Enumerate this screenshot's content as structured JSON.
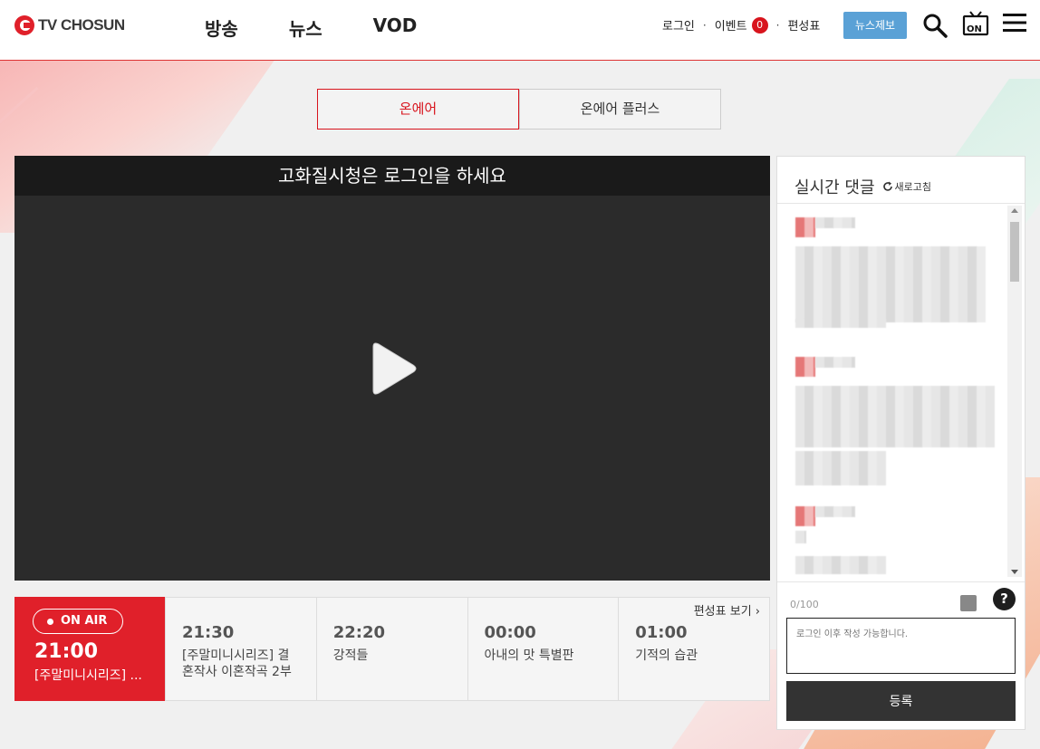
{
  "header": {
    "logo_text": "TV CHOSUN",
    "nav": [
      "방송",
      "뉴스",
      "VOD"
    ],
    "util": {
      "login": "로그인",
      "event": "이벤트",
      "event_count": "0",
      "schedule": "편성표"
    },
    "report_button": "뉴스제보"
  },
  "tabs": [
    {
      "label": "온에어",
      "active": true
    },
    {
      "label": "온에어 플러스",
      "active": false
    }
  ],
  "player": {
    "banner": "고화질시청은 로그인을 하세요"
  },
  "schedule": {
    "onair_label": "ON AIR",
    "current": {
      "time": "21:00",
      "title": "[주말미니시리즈] ..."
    },
    "link": "편성표 보기",
    "slots": [
      {
        "time": "21:30",
        "title": "[주말미니시리즈] 결혼작사 이혼작곡 2부"
      },
      {
        "time": "22:20",
        "title": "강적들"
      },
      {
        "time": "00:00",
        "title": "아내의 맛 특별판"
      },
      {
        "time": "01:00",
        "title": "기적의 습관"
      }
    ]
  },
  "comments": {
    "title": "실시간 댓글",
    "refresh": "새로고침",
    "counter": "0/100",
    "placeholder": "로그인 이후 작성 가능합니다.",
    "help": "?",
    "submit": "등록"
  },
  "colors": {
    "brand_red": "#e0202a",
    "report_blue": "#5aa1d6",
    "dark": "#333333"
  }
}
